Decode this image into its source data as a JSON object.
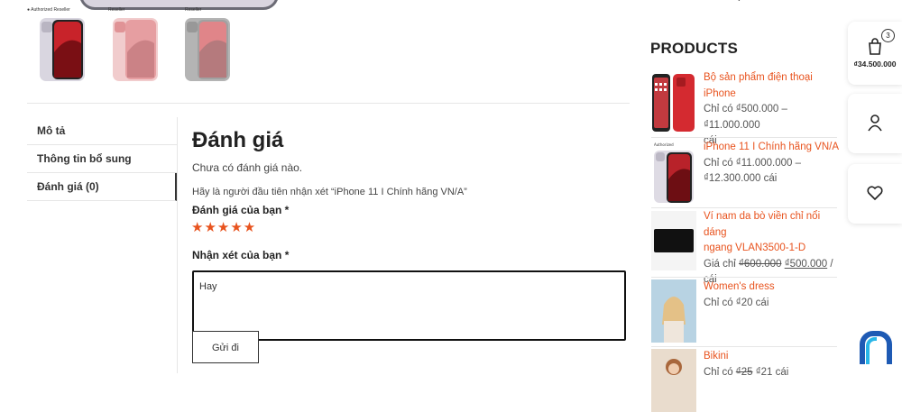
{
  "badges": {
    "apple_top": "Authorized Reseller",
    "apple_thumb": "Reseller"
  },
  "tabs": [
    {
      "label": "Mô tả"
    },
    {
      "label": "Thông tin bổ sung"
    },
    {
      "label": "Đánh giá (0)"
    }
  ],
  "review": {
    "title": "Đánh giá",
    "no_reviews": "Chưa có đánh giá nào.",
    "first_review": "Hãy là người đầu tiên nhận xét “iPhone 11 I Chính hãng VN/A”",
    "rating_label": "Đánh giá của bạn *",
    "stars": "★★★★★",
    "comment_label": "Nhận xét của bạn *",
    "comment_value": "Hay",
    "submit_label": "Gửi đi"
  },
  "sidebar": {
    "title": "PRODUCTS",
    "products": [
      {
        "name": "Bộ sản phẩm điện thoại iPhone",
        "price_line1": "Chỉ có ₫500.000 – ₫11.000.000",
        "price_line2": "cái"
      },
      {
        "name": "iPhone 11 I Chính hãng VN/A",
        "price_line1": "Chỉ có ₫11.000.000 –",
        "price_line2": "₫12.300.000 cái"
      },
      {
        "name_line1": "Ví nam da bò viền chỉ nổi dáng",
        "name_line2": "ngang VLAN3500-1-D",
        "price_prefix": "Giá chỉ ",
        "old_price": "₫600.000",
        "new_price": "₫500.000",
        "price_suffix": " /",
        "price_line2": "cái"
      },
      {
        "name": "Women's dress",
        "price_line1": "Chỉ có ₫20 cái"
      },
      {
        "name": "Bikini",
        "price_prefix": "Chỉ có ",
        "old_price": "₫25",
        "new_price": "₫21",
        "price_suffix": " cái"
      }
    ]
  },
  "floating": {
    "cart_count": "3",
    "cart_total": "₫34.500.000",
    "icons": [
      "cart-icon",
      "user-icon",
      "heart-icon"
    ]
  },
  "colors": {
    "accent": "#e8531e",
    "text": "#333333",
    "border": "#e6e6e6"
  }
}
